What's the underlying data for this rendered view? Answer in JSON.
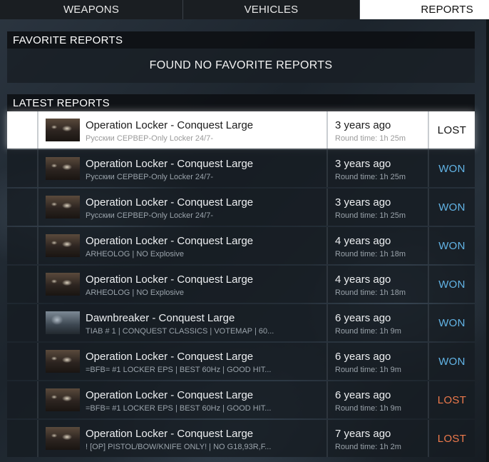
{
  "tabs": [
    {
      "label": "WEAPONS"
    },
    {
      "label": "VEHICLES"
    },
    {
      "label": "REPORTS",
      "active": true
    }
  ],
  "favorites": {
    "title": "FAVORITE REPORTS",
    "empty_message": "FOUND NO FAVORITE REPORTS"
  },
  "latest": {
    "title": "LATEST REPORTS",
    "rows": [
      {
        "map": "Operation Locker - Conquest Large",
        "server": "Русскии СЕРВЕР-Only Locker 24/7-",
        "ago": "3 years ago",
        "round": "Round time: 1h 25m",
        "result": "LOST",
        "selected": true
      },
      {
        "map": "Operation Locker - Conquest Large",
        "server": "Русскии СЕРВЕР-Only Locker 24/7-",
        "ago": "3 years ago",
        "round": "Round time: 1h 25m",
        "result": "WON"
      },
      {
        "map": "Operation Locker - Conquest Large",
        "server": "Русскии СЕРВЕР-Only Locker 24/7-",
        "ago": "3 years ago",
        "round": "Round time: 1h 25m",
        "result": "WON"
      },
      {
        "map": "Operation Locker - Conquest Large",
        "server": "ARHEOLOG | NO Explosive",
        "ago": "4 years ago",
        "round": "Round time: 1h 18m",
        "result": "WON"
      },
      {
        "map": "Operation Locker - Conquest Large",
        "server": "ARHEOLOG | NO Explosive",
        "ago": "4 years ago",
        "round": "Round time: 1h 18m",
        "result": "WON"
      },
      {
        "map": "Dawnbreaker - Conquest Large",
        "server": "TIAB # 1 | CONQUEST CLASSICS | VOTEMAP | 60...",
        "ago": "6 years ago",
        "round": "Round time: 1h 9m",
        "result": "WON"
      },
      {
        "map": "Operation Locker - Conquest Large",
        "server": "=BFB= #1 LOCKER EPS | BEST 60Hz | GOOD HIT...",
        "ago": "6 years ago",
        "round": "Round time: 1h 9m",
        "result": "WON"
      },
      {
        "map": "Operation Locker - Conquest Large",
        "server": "=BFB= #1 LOCKER EPS | BEST 60Hz | GOOD HIT...",
        "ago": "6 years ago",
        "round": "Round time: 1h 9m",
        "result": "LOST"
      },
      {
        "map": "Operation Locker - Conquest Large",
        "server": "! [OP] PISTOL/BOW/KNIFE ONLY! | NO G18,93R,F...",
        "ago": "7 years ago",
        "round": "Round time: 1h 2m",
        "result": "LOST"
      }
    ]
  },
  "colors": {
    "won": "#62b4e6",
    "lost": "#ee7a4c",
    "active_tab_bg": "#ffffff"
  }
}
